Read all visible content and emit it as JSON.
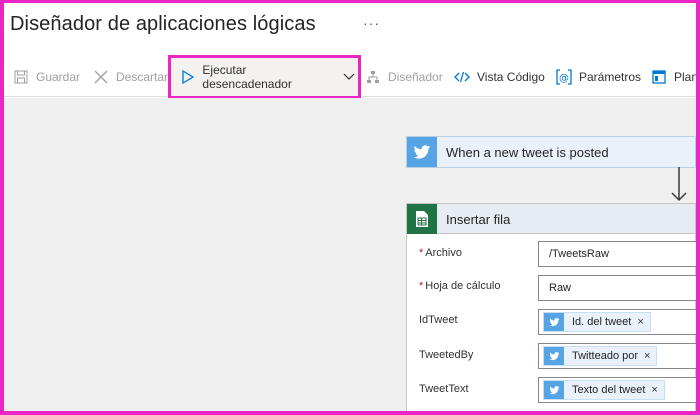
{
  "header": {
    "title": "Diseñador de aplicaciones lógicas",
    "more": "···"
  },
  "toolbar": {
    "save": "Guardar",
    "discard": "Descartar",
    "run_trigger": "Ejecutar desencadenador",
    "designer": "Diseñador",
    "code_view": "Vista Código",
    "parameters": "Parámetros",
    "templates": "Plan"
  },
  "trigger": {
    "label": "When a new tweet is posted",
    "icon": "twitter-icon"
  },
  "action": {
    "label": "Insertar fila",
    "icon": "sheets-icon",
    "fields": [
      {
        "label": "Archivo",
        "required": "*",
        "value": "/TweetsRaw"
      },
      {
        "label": "Hoja de cálculo",
        "required": "*",
        "value": "Raw"
      },
      {
        "label": "IdTweet",
        "token": "Id. del tweet"
      },
      {
        "label": "TweetedBy",
        "token": "Twitteado por"
      },
      {
        "label": "TweetText",
        "token": "Texto del tweet"
      }
    ],
    "remove_glyph": "×"
  },
  "colors": {
    "highlight": "#ec26c5",
    "twitter": "#56a3e6",
    "sheets": "#1f7345",
    "accent": "#0078d4"
  }
}
